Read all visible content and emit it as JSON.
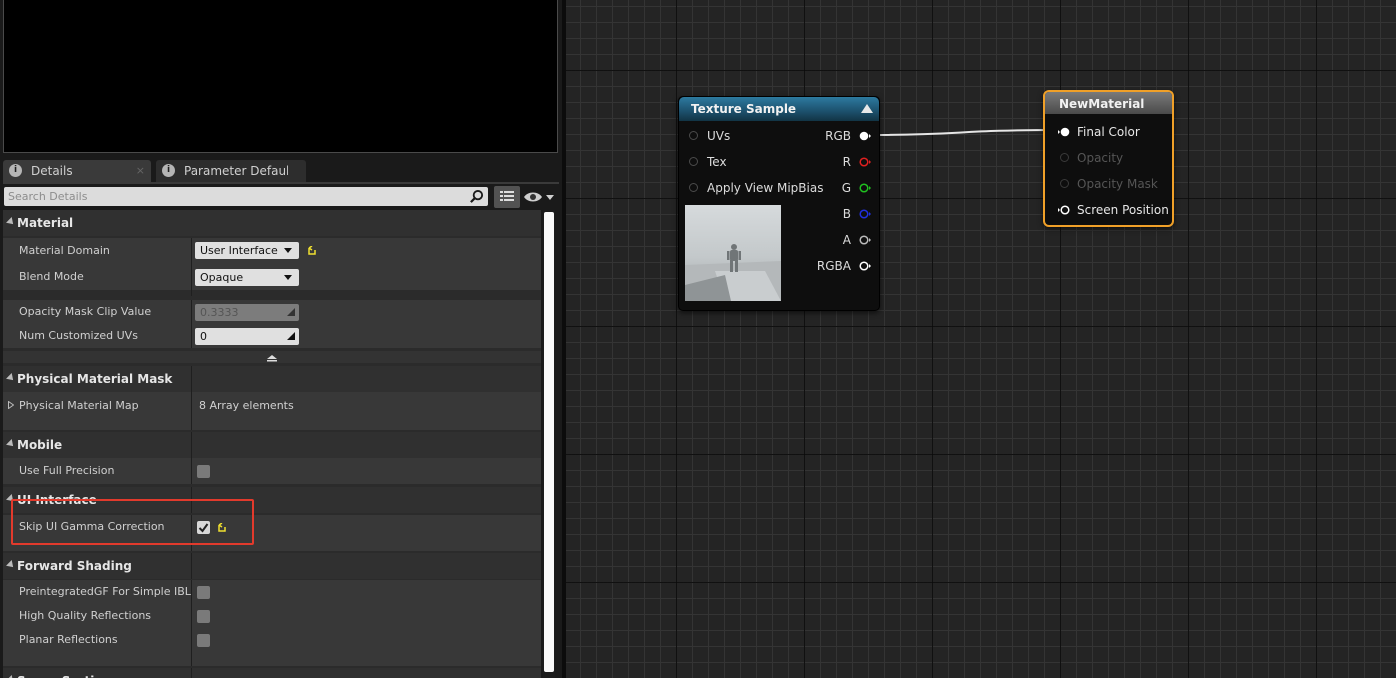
{
  "details_panel": {
    "tabs": [
      {
        "label": "Details",
        "close": "×"
      },
      {
        "label": "Parameter Defaults"
      }
    ],
    "search_placeholder": "Search Details",
    "categories": {
      "material": {
        "title": "Material",
        "rows": [
          {
            "label": "Material Domain",
            "value": "User Interface"
          },
          {
            "label": "Blend Mode",
            "value": "Opaque"
          },
          {
            "label": "Opacity Mask Clip Value",
            "value": "0.3333"
          },
          {
            "label": "Num Customized UVs",
            "value": "0"
          }
        ]
      },
      "physical_material_mask": {
        "title": "Physical Material Mask",
        "rows": [
          {
            "label": "Physical Material Map",
            "value": "8 Array elements"
          }
        ]
      },
      "mobile": {
        "title": "Mobile",
        "rows": [
          {
            "label": "Use Full Precision",
            "checked": false
          }
        ]
      },
      "ui_interface": {
        "title": "UI Interface",
        "rows": [
          {
            "label": "Skip UI Gamma Correction",
            "checked": true
          }
        ]
      },
      "forward_shading": {
        "title": "Forward Shading",
        "rows": [
          {
            "label": "PreintegratedGF For Simple IBL",
            "checked": false
          },
          {
            "label": "High Quality Reflections",
            "checked": false
          },
          {
            "label": "Planar Reflections",
            "checked": false
          }
        ]
      },
      "cut_off": {
        "title": "Scene Sorting"
      }
    }
  },
  "graph": {
    "texture_sample_node": {
      "title": "Texture Sample",
      "inputs": [
        "UVs",
        "Tex",
        "Apply View MipBias"
      ],
      "outputs": [
        {
          "label": "RGB",
          "color": "#ffffff"
        },
        {
          "label": "R",
          "color": "#e02020"
        },
        {
          "label": "G",
          "color": "#20c020"
        },
        {
          "label": "B",
          "color": "#2030e0"
        },
        {
          "label": "A",
          "color": "#bbbbbb"
        },
        {
          "label": "RGBA",
          "color": "#ffffff"
        }
      ]
    },
    "material_node": {
      "title": "NewMaterial",
      "inputs": [
        {
          "label": "Final Color",
          "enabled": true
        },
        {
          "label": "Opacity",
          "enabled": false
        },
        {
          "label": "Opacity Mask",
          "enabled": false
        },
        {
          "label": "Screen Position",
          "enabled": true
        }
      ],
      "accent_color": "#f0a028"
    }
  }
}
